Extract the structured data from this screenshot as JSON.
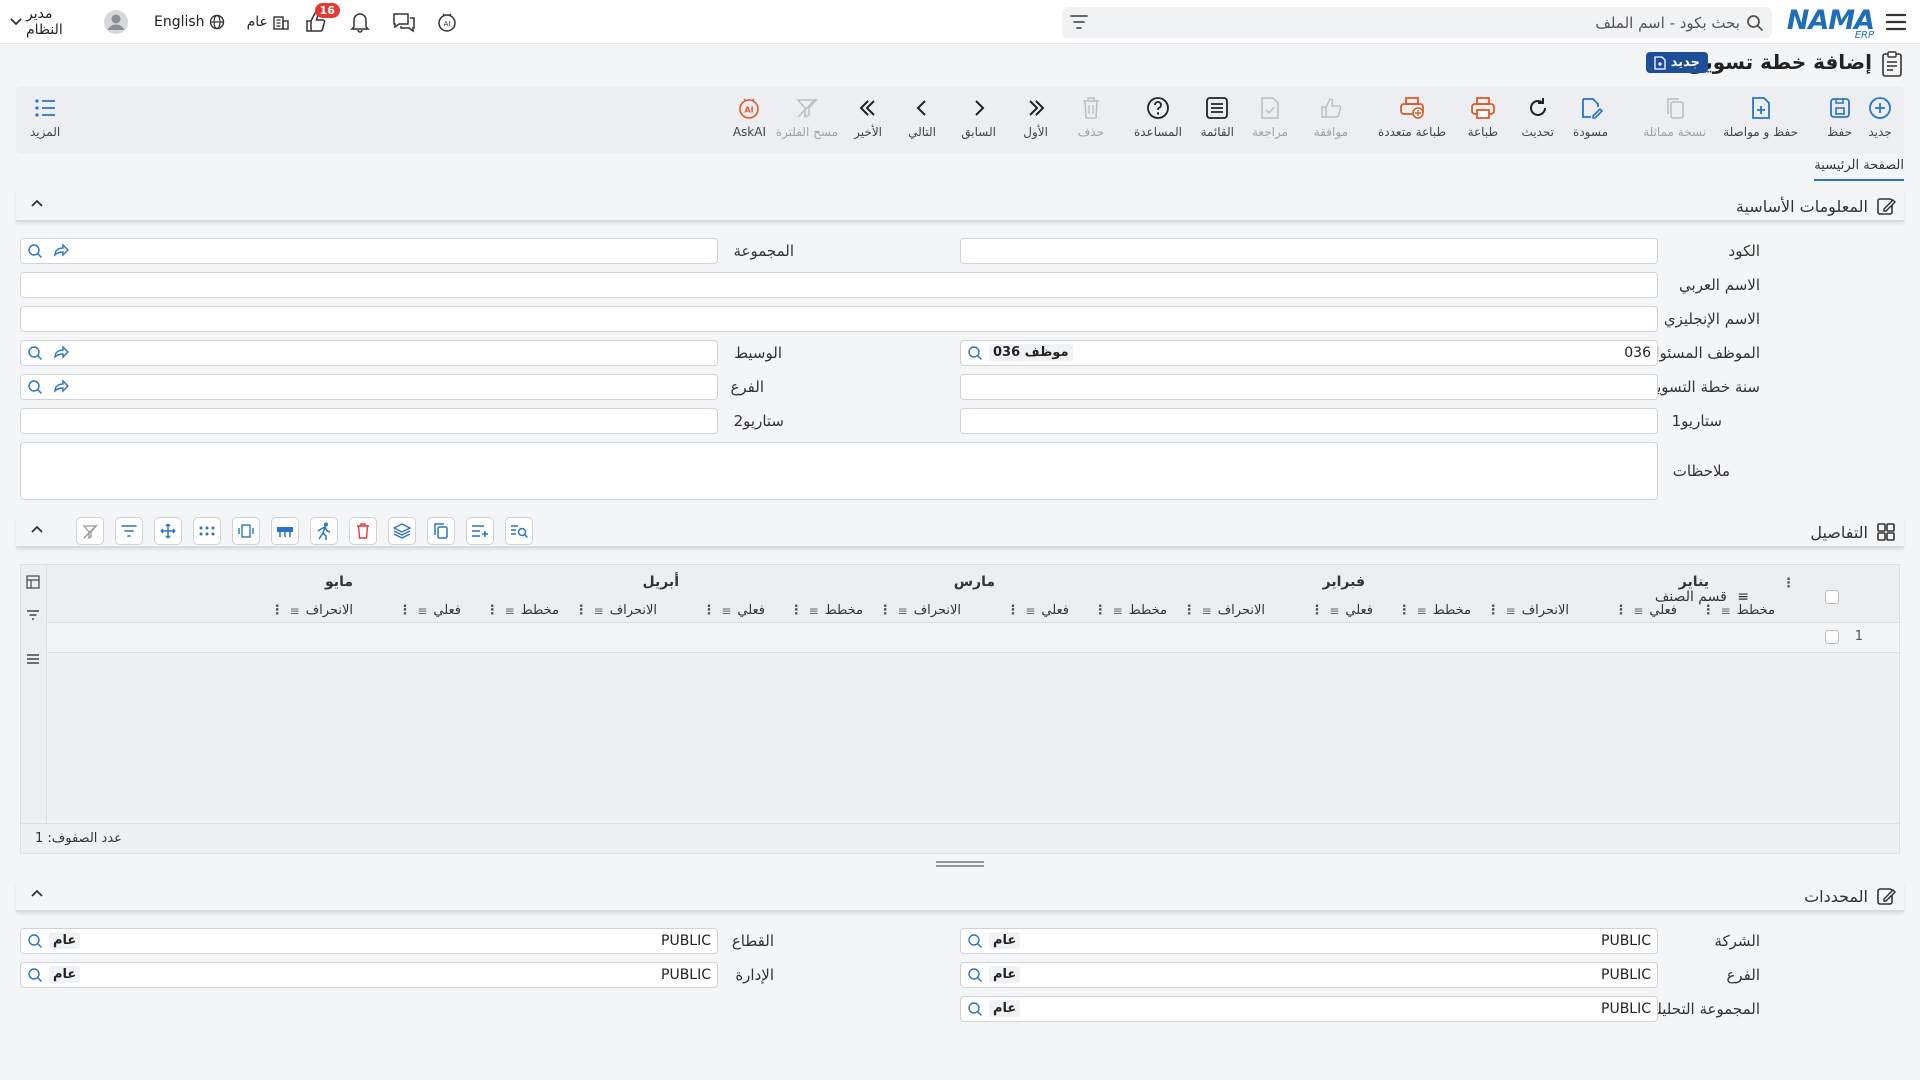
{
  "topbar": {
    "search_placeholder": "بحث بكود - اسم الملف",
    "logo_text": "NAMA",
    "logo_sub": "ERP",
    "user_name": "مدير النظام",
    "language": "English",
    "scope": "عام",
    "notif_count": "16"
  },
  "page": {
    "title": "إضافة خطة تسويق",
    "new_badge": "جديد",
    "tab_main": "الصفحة الرئيسية"
  },
  "actions": {
    "new": "جديد",
    "save": "حفظ",
    "save_continue": "حفظ و مواصلة",
    "copy": "نسخة مماثلة",
    "draft": "مسودة",
    "refresh": "تحديث",
    "print": "طباعة",
    "multi_print": "طباعة متعددة",
    "approve": "موافقة",
    "review": "مراجعة",
    "list": "القائمة",
    "help": "المساعدة",
    "delete": "حذف",
    "first": "الأول",
    "previous": "السابق",
    "next": "التالي",
    "last": "الأخير",
    "clear_filter": "مسح الفلترة",
    "askai": "AskAI",
    "more": "المزيد"
  },
  "basic_info": {
    "section_title": "المعلومات الأساسية",
    "code_label": "الكود",
    "code_value": "",
    "group_label": "المجموعة",
    "group_value": "",
    "arabic_name_label": "الاسم العربي",
    "english_name_label": "الاسم الإنجليزي",
    "employee_label": "الموظف المسئول",
    "employee_code": "036",
    "employee_name": "موظف 036",
    "broker_label": "الوسيط",
    "year_label": "سنة خطة التسويق",
    "branch_label": "الفرع",
    "scenario1_label": "ستاريو1",
    "scenario2_label": "ستاريو2",
    "notes_label": "ملاحظات"
  },
  "details": {
    "section_title": "التفاصيل",
    "category_header": "قسم الصنف",
    "months": [
      "يناير",
      "فبراير",
      "مارس",
      "أبريل",
      "مايو"
    ],
    "sub_headers": [
      "مخطط",
      "فعلي",
      "الانحراف"
    ],
    "row_number": "1",
    "row_count_label": "عدد الصفوف: 1"
  },
  "determinants": {
    "section_title": "المحددات",
    "company_label": "الشركة",
    "company_value": "PUBLIC",
    "company_tag": "عام",
    "sector_label": "القطاع",
    "sector_value": "PUBLIC",
    "sector_tag": "عام",
    "branch_label": "الفرع",
    "branch_value": "PUBLIC",
    "branch_tag": "عام",
    "admin_label": "الإدارة",
    "admin_value": "PUBLIC",
    "admin_tag": "عام",
    "analytic_label": "المجموعة التحليلية",
    "analytic_value": "PUBLIC",
    "analytic_tag": "عام"
  }
}
